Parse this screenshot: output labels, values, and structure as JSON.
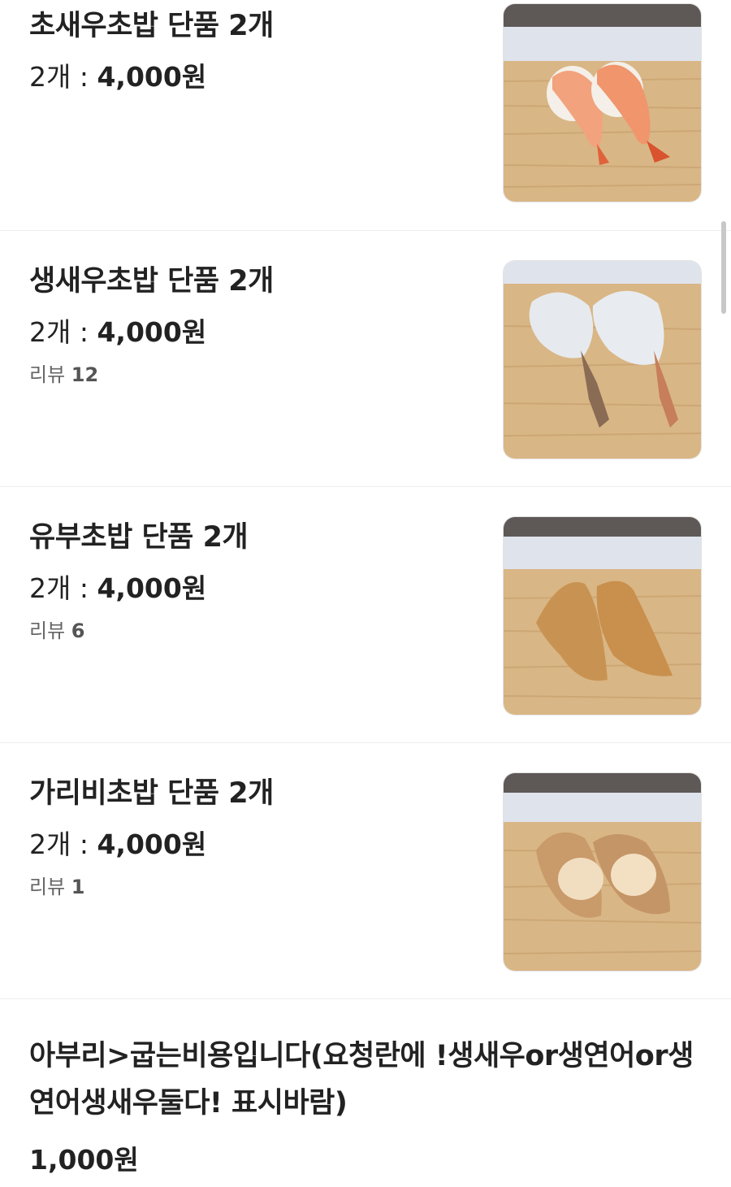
{
  "menu": {
    "items": [
      {
        "name": "초새우초밥 단품 2개",
        "qty": "2개 : ",
        "price": "4,000원",
        "review_label": "",
        "review_count": "",
        "image": "shrimp-nigiri-cooked"
      },
      {
        "name": "생새우초밥 단품 2개",
        "qty": "2개 : ",
        "price": "4,000원",
        "review_label": "리뷰 ",
        "review_count": "12",
        "image": "shrimp-nigiri-raw"
      },
      {
        "name": "유부초밥 단품 2개",
        "qty": "2개 : ",
        "price": "4,000원",
        "review_label": "리뷰 ",
        "review_count": "6",
        "image": "inari-sushi"
      },
      {
        "name": "가리비초밥 단품 2개",
        "qty": "2개 : ",
        "price": "4,000원",
        "review_label": "리뷰 ",
        "review_count": "1",
        "image": "scallop-nigiri"
      }
    ],
    "last_item": {
      "name": "아부리>굽는비용입니다(요청란에 !생새우or생연어or생연어생새우둘다! 표시바람)",
      "price": "1,000원"
    }
  },
  "colors": {
    "text_primary": "#222222",
    "text_secondary": "#666666",
    "divider": "#eeeeee",
    "wood": "#d9b685",
    "backdrop": "#dfe3ec"
  }
}
